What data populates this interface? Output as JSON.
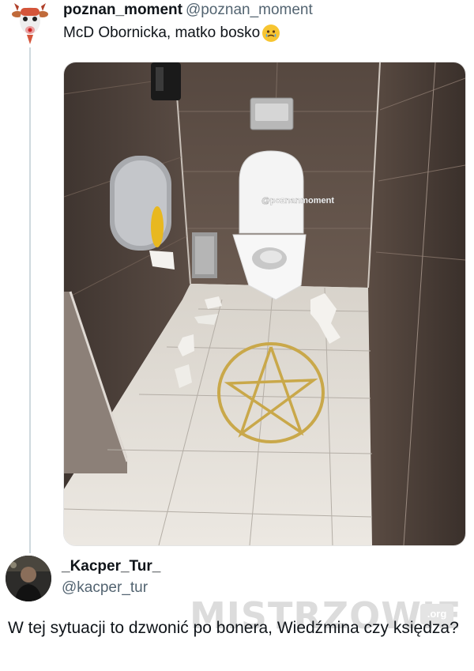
{
  "tweet": {
    "display_name": "poznan_moment",
    "handle": "@poznan_moment",
    "text": "McD Obornicka, matko bosko",
    "emoji_icon": "face-holding-back-tears-emoji",
    "photo_watermark": "@poznanmoment"
  },
  "reply": {
    "display_name": "_Kacper_Tur_",
    "handle": "@kacper_tur",
    "text": "W tej sytuacji to dzwonić po bonera, Wiedźmina czy księdza?"
  },
  "site_watermark": {
    "text": "MISTRZOWIE",
    "badge": ".org"
  },
  "colors": {
    "text": "#0f1419",
    "secondary": "#536471",
    "thread_line": "#cfd9de"
  }
}
